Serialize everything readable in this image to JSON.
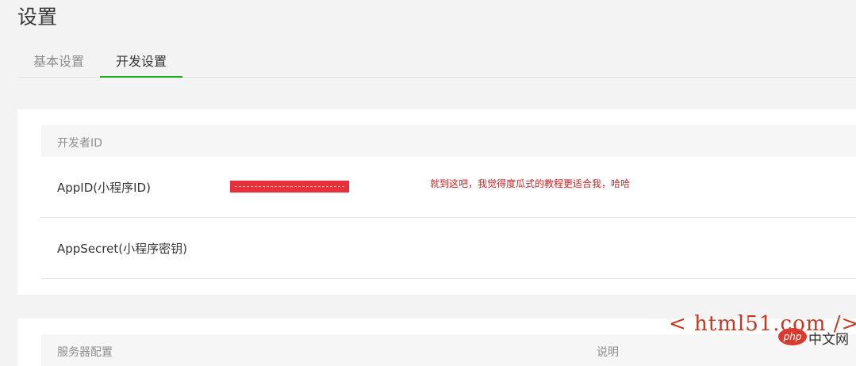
{
  "page": {
    "title": "设置"
  },
  "tabs": [
    {
      "label": "基本设置",
      "active": false
    },
    {
      "label": "开发设置",
      "active": true
    }
  ],
  "dev_id_card": {
    "header": "开发者ID",
    "rows": [
      {
        "label": "AppID(小程序ID)",
        "value_masked": true
      },
      {
        "label": "AppSecret(小程序密钥)"
      }
    ],
    "annotation": "就到这吧，我觉得度瓜式的教程更适合我，哈哈"
  },
  "server_card": {
    "header_left": "服务器配置",
    "header_right": "说明"
  },
  "watermarks": {
    "site": "< html51.com />",
    "php_logo": "php",
    "php_cn": "中文网"
  },
  "colors": {
    "accent": "#1aad19",
    "mask": "#e8303a",
    "annotation": "#d12020",
    "background": "#f3f3f3"
  }
}
